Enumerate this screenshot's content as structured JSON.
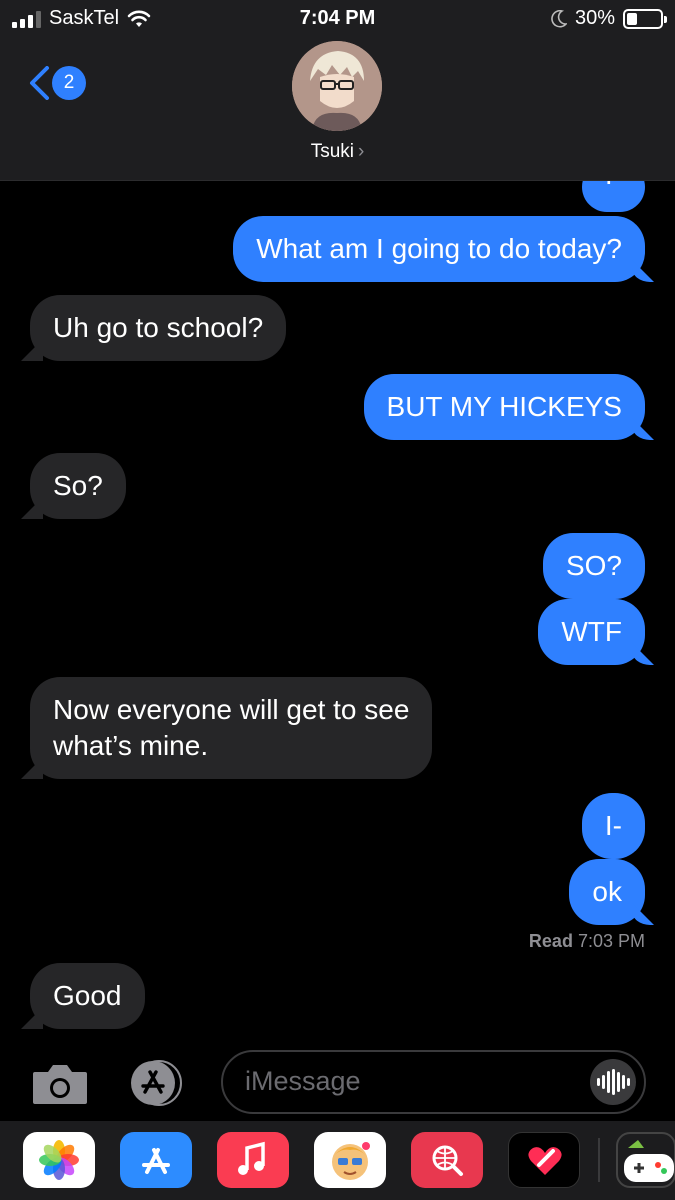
{
  "status_bar": {
    "carrier": "SaskTel",
    "time": "7:04 PM",
    "battery": "30%",
    "battery_level": 0.3,
    "icons": [
      "signal-icon",
      "wifi-icon",
      "moon-icon",
      "battery-icon"
    ]
  },
  "header": {
    "back_badge": "2",
    "contact_name": "Tsuki",
    "contact_arrow": "›"
  },
  "messages": [
    {
      "side": "out",
      "text": "I-"
    },
    {
      "side": "out",
      "text": "What am I going to do today?"
    },
    {
      "side": "in",
      "text": "Uh go to school?"
    },
    {
      "side": "out",
      "text": "BUT MY HICKEYS"
    },
    {
      "side": "in",
      "text": "So?"
    },
    {
      "side": "out",
      "text": "SO?"
    },
    {
      "side": "out",
      "text": "WTF"
    },
    {
      "side": "in",
      "text": "Now everyone will get to see"
    },
    {
      "side": "in",
      "text": "what’s mine."
    },
    {
      "side": "out",
      "text": "I-"
    },
    {
      "side": "out",
      "text": "ok"
    },
    {
      "side": "in",
      "text": "Good"
    }
  ],
  "read_receipt": {
    "label": "Read",
    "time": "7:03 PM"
  },
  "input": {
    "placeholder": "iMessage"
  },
  "app_drawer": {
    "apps": [
      "photos-app-icon",
      "app-store-icon",
      "music-app-icon",
      "memoji-icon",
      "web-search-app-icon",
      "digital-touch-icon",
      "game-app-icon"
    ]
  },
  "colors": {
    "outgoing_bubble": "#2f80ff",
    "incoming_bubble": "#262628",
    "background": "#000000"
  }
}
